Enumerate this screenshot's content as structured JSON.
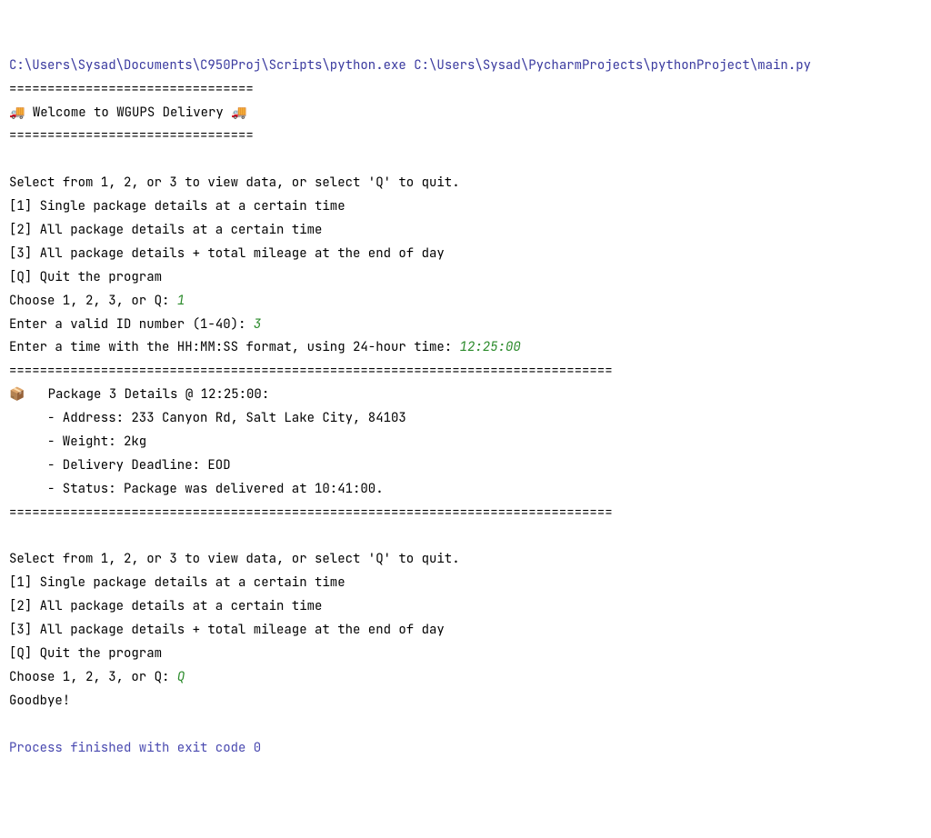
{
  "header": {
    "exe_path": "C:\\Users\\Sysad\\Documents\\C950Proj\\Scripts\\python.exe",
    "script_path": "C:\\Users\\Sysad\\PycharmProjects\\pythonProject\\main.py"
  },
  "banner": {
    "rule": "================================",
    "truck_emoji": "🚚",
    "title": " Welcome to WGUPS Delivery "
  },
  "menu": {
    "prompt": "Select from 1, 2, or 3 to view data, or select 'Q' to quit.",
    "options": [
      "[1] Single package details at a certain time",
      "[2] All package details at a certain time",
      "[3] All package details + total mileage at the end of day",
      "[Q] Quit the program"
    ],
    "choose_prompt": "Choose 1, 2, 3, or Q: "
  },
  "first_run": {
    "choice": "1",
    "id_prompt": "Enter a valid ID number (1-40): ",
    "id_value": "3",
    "time_prompt": "Enter a time with the HH:MM:SS format, using 24-hour time: ",
    "time_value": "12:25:00"
  },
  "detail": {
    "rule": "===============================================================================",
    "icon": "📦",
    "header": "   Package 3 Details @ 12:25:00:",
    "address": "     - Address: 233 Canyon Rd, Salt Lake City, 84103",
    "weight": "     - Weight: 2kg",
    "deadline": "     - Delivery Deadline: EOD",
    "status": "     - Status: Package was delivered at 10:41:00."
  },
  "second_run": {
    "choice": "Q",
    "goodbye": "Goodbye!"
  },
  "footer": {
    "process": "Process finished with exit code 0"
  }
}
